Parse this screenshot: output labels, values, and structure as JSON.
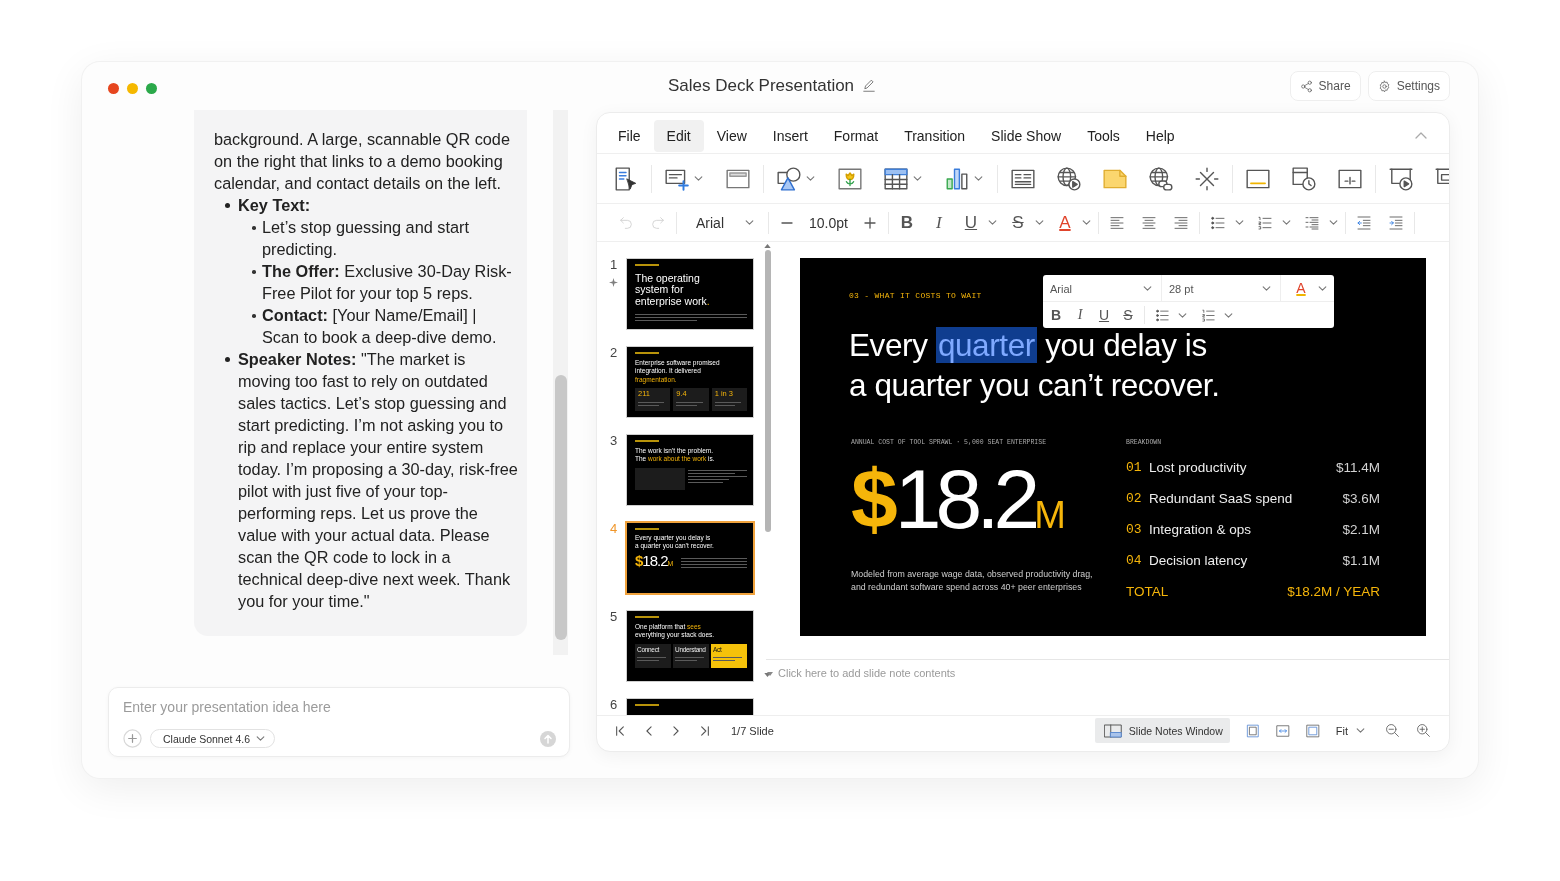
{
  "window": {
    "title": "Sales Deck Presentation",
    "actions": [
      {
        "kind": "share",
        "label": "Share"
      },
      {
        "kind": "settings",
        "label": "Settings"
      }
    ]
  },
  "chat": {
    "message": {
      "paragraph": "background. A large, scannable QR code on the right that links to a demo booking calendar, and contact details on the left.",
      "items": [
        {
          "label": "Key Text:",
          "children": [
            {
              "text": "Let’s stop guessing and start predicting."
            },
            {
              "text": "**The Offer:** Exclusive 30-Day Risk-Free Pilot for your top 5 reps."
            },
            {
              "text": "**Contact:** [Your Name/Email] | Scan to book a deep-dive demo."
            }
          ]
        },
        {
          "text": "**Speaker Notes:** \"The market is moving too fast to rely on outdated sales tactics. Let’s stop guessing and start predicting. I’m not asking you to rip and replace your entire system today. I’m proposing a 30-day, risk-free pilot with just five of your top-performing reps. Let us prove the value with your actual data. Please scan the QR code to lock in a technical deep-dive next week. Thank you for your time.\""
        }
      ]
    },
    "composer": {
      "placeholder": "Enter your presentation idea here",
      "model": "Claude Sonnet 4.6"
    }
  },
  "editor": {
    "menu": [
      {
        "label": "File",
        "selected": false
      },
      {
        "label": "Edit",
        "selected": true
      },
      {
        "label": "View",
        "selected": false
      },
      {
        "label": "Insert",
        "selected": false
      },
      {
        "label": "Format",
        "selected": false
      },
      {
        "label": "Transition",
        "selected": false
      },
      {
        "label": "Slide Show",
        "selected": false
      },
      {
        "label": "Tools",
        "selected": false
      },
      {
        "label": "Help",
        "selected": false
      }
    ],
    "format_bar": {
      "history": [
        {
          "kind": "undo",
          "disabled": true
        },
        {
          "kind": "redo",
          "disabled": true
        }
      ],
      "font": "Arial",
      "size": "10.0pt",
      "styles": [
        {
          "kind": "bold",
          "glyph": "B",
          "menu": false
        },
        {
          "kind": "italic",
          "glyph": "I",
          "menu": false
        },
        {
          "kind": "underline",
          "glyph": "U",
          "menu": true
        },
        {
          "kind": "strike",
          "glyph": "S",
          "menu": true
        },
        {
          "kind": "color",
          "glyph": "A",
          "menu": true
        }
      ]
    },
    "thumbnails": [
      {
        "number": "1",
        "kind": "cover",
        "selected": false,
        "marked": true,
        "title": [
          {
            "text": "The operating system for enterprise work",
            "accent": false
          },
          {
            "text": ".",
            "accent": true
          }
        ]
      },
      {
        "number": "2",
        "kind": "stats",
        "selected": false,
        "marked": false,
        "title": [
          {
            "text": "Enterprise software promised integration. It delivered ",
            "accent": false
          },
          {
            "text": "fragmentation.",
            "accent": true
          }
        ],
        "stats": [
          "211",
          "9.4",
          "1 in 3"
        ]
      },
      {
        "number": "3",
        "kind": "split",
        "selected": false,
        "marked": false,
        "title": [
          {
            "text": "The work isn’t the problem. The ",
            "accent": false
          },
          {
            "text": "work about the work",
            "accent": true
          },
          {
            "text": " is.",
            "accent": false
          }
        ]
      },
      {
        "number": "4",
        "kind": "metric",
        "selected": true,
        "marked": false,
        "title": [
          {
            "text": "Every quarter you delay is a quarter you can’t recover.",
            "accent": false
          }
        ],
        "figure": {
          "currency": "$",
          "amount": "18.2",
          "unit": "M"
        }
      },
      {
        "number": "5",
        "kind": "cards",
        "selected": false,
        "marked": false,
        "title": [
          {
            "text": "One platform that ",
            "accent": false
          },
          {
            "text": "sees",
            "accent": true
          },
          {
            "text": " everything your stack does.",
            "accent": false
          }
        ],
        "cards": [
          {
            "label": "Connect",
            "highlighted": false
          },
          {
            "label": "Understand",
            "highlighted": false
          },
          {
            "label": "Act",
            "highlighted": true
          }
        ]
      },
      {
        "number": "6",
        "kind": "partial",
        "selected": false,
        "marked": false
      }
    ],
    "slide": {
      "kicker": "03 - WHAT IT COSTS TO WAIT",
      "headline": [
        [
          {
            "text": "Every ",
            "selected": false
          },
          {
            "text": "quarter",
            "selected": true
          },
          {
            "text": " you delay is",
            "selected": false
          }
        ],
        [
          {
            "text": "a quarter you can’t recover.",
            "selected": false
          }
        ]
      ],
      "metric": {
        "label": "ANNUAL COST OF TOOL SPRAWL · 5,000 SEAT ENTERPRISE",
        "currency": "$",
        "amount": "18.2",
        "unit": "M",
        "note": "Modeled from average wage data, observed productivity drag, and redundant software spend across 40+ peer enterprises"
      },
      "breakdown": {
        "title": "BREAKDOWN",
        "rows": [
          {
            "index": "01",
            "label": "Lost productivity",
            "value": "$11.4M"
          },
          {
            "index": "02",
            "label": "Redundant SaaS spend",
            "value": "$3.6M"
          },
          {
            "index": "03",
            "label": "Integration & ops",
            "value": "$2.1M"
          },
          {
            "index": "04",
            "label": "Decision latency",
            "value": "$1.1M"
          }
        ],
        "total": {
          "label": "TOTAL",
          "value": "$18.2M / YEAR"
        }
      }
    },
    "floating_toolbar": {
      "font": "Arial",
      "size": "28 pt",
      "color_glyph": "A",
      "styles": [
        {
          "kind": "bold",
          "glyph": "B"
        },
        {
          "kind": "italic",
          "glyph": "I"
        },
        {
          "kind": "underline",
          "glyph": "U"
        },
        {
          "kind": "strike",
          "glyph": "S"
        }
      ]
    },
    "notes": {
      "placeholder": "Click here to add slide note contents"
    },
    "status_bar": {
      "counter": "1/7 Slide",
      "notes_button": {
        "label": "Slide Notes Window",
        "selected": true
      },
      "zoom": "Fit"
    }
  }
}
